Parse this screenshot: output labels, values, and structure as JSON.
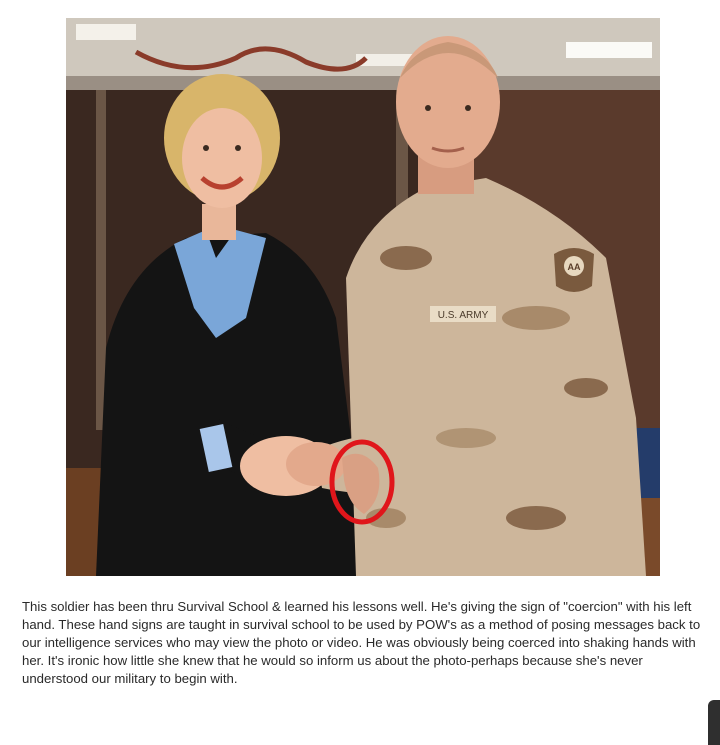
{
  "caption": {
    "text": "This soldier has been thru Survival School & learned his lessons well. He's giving the sign of \"coercion\" with his left hand. These hand signs are taught in survival school to be used by POW's as a method of posing messages back to our intelligence services who may view the photo or video. He was obviously being coerced into shaking hands with her. It's ironic how little she knew that he would so inform us about the photo-perhaps because she's never understood our military to begin with."
  },
  "photo": {
    "uniform_tape": "U.S. ARMY",
    "shoulder_patch": "AA",
    "highlight_color": "#e0161b"
  }
}
